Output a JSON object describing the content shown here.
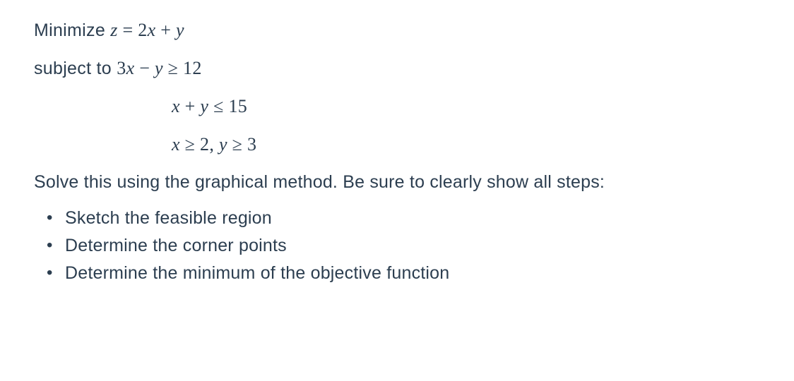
{
  "objective": {
    "label": "Minimize ",
    "variable": "z",
    "equals": " = ",
    "expression_parts": [
      "2",
      "x",
      " + ",
      "y"
    ]
  },
  "subject_to": {
    "label": "subject to  ",
    "constraints": [
      {
        "parts": [
          "3",
          "x",
          " − ",
          "y",
          " ≥ ",
          "12"
        ]
      },
      {
        "parts": [
          "x",
          " + ",
          "y",
          " ≤ ",
          "15"
        ]
      },
      {
        "parts": [
          "x",
          " ≥ ",
          "2",
          ",  ",
          "y",
          " ≥ ",
          "3"
        ]
      }
    ]
  },
  "instruction": "Solve this using the graphical method.  Be sure to clearly show all steps:",
  "steps": [
    "Sketch the feasible region",
    "Determine the corner points",
    "Determine the minimum of the objective function"
  ]
}
